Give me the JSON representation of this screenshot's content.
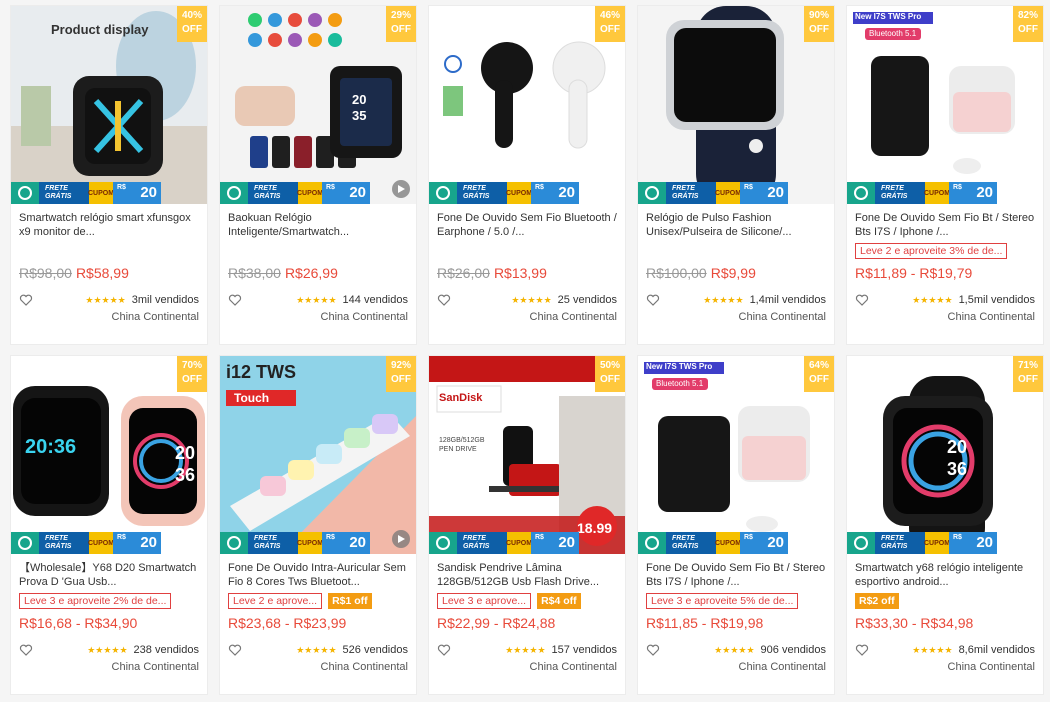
{
  "strip": {
    "frete_line1": "FRETE",
    "frete_line2": "GRÁTIS",
    "cupom": "CUPOM",
    "r_prefix": "R$",
    "r_value": "20"
  },
  "products": [
    {
      "discount": "40%",
      "discount_label": "OFF",
      "image_label": "Product display",
      "title": "Smartwatch relógio smart xfunsgox x9 monitor de...",
      "promo": "",
      "badge": "",
      "price_old": "R$98,00",
      "price": "R$58,99",
      "stars": "★★★★★",
      "sold": "3mil vendidos",
      "location": "China Continental",
      "video": false
    },
    {
      "discount": "29%",
      "discount_label": "OFF",
      "image_label": "",
      "title": "Baokuan Relógio Inteligente/Smartwatch...",
      "promo": "",
      "badge": "",
      "price_old": "R$38,00",
      "price": "R$26,99",
      "stars": "★★★★★",
      "sold": "144 vendidos",
      "location": "China Continental",
      "video": true
    },
    {
      "discount": "46%",
      "discount_label": "OFF",
      "image_label": "",
      "title": "Fone De Ouvido Sem Fio Bluetooth / Earphone / 5.0 /...",
      "promo": "",
      "badge": "",
      "price_old": "R$26,00",
      "price": "R$13,99",
      "stars": "★★★★★",
      "sold": "25 vendidos",
      "location": "China Continental",
      "video": false
    },
    {
      "discount": "90%",
      "discount_label": "OFF",
      "image_label": "",
      "title": "Relógio de Pulso Fashion Unisex/Pulseira de Silicone/...",
      "promo": "",
      "badge": "",
      "price_old": "R$100,00",
      "price": "R$9,99",
      "stars": "★★★★★",
      "sold": "1,4mil vendidos",
      "location": "China Continental",
      "video": false
    },
    {
      "discount": "82%",
      "discount_label": "OFF",
      "image_label": "New I7S TWS Pro",
      "title": "Fone De Ouvido Sem Fio Bt / Stereo Bts I7S / Iphone /...",
      "promo": "Leve 2 e aproveite 3% de de...",
      "badge": "",
      "price_old": "",
      "price": "R$11,89 - R$19,79",
      "stars": "★★★★★",
      "sold": "1,5mil vendidos",
      "location": "China Continental",
      "video": false
    },
    {
      "discount": "70%",
      "discount_label": "OFF",
      "image_label": "",
      "title": "【Wholesale】Y68 D20 Smartwatch Prova D 'Gua Usb...",
      "promo": "Leve 3 e aproveite 2% de de...",
      "badge": "",
      "price_old": "",
      "price": "R$16,68 - R$34,90",
      "stars": "★★★★★",
      "sold": "238 vendidos",
      "location": "China Continental",
      "video": false
    },
    {
      "discount": "92%",
      "discount_label": "OFF",
      "image_label": "i12 TWS",
      "title": "Fone De Ouvido Intra-Auricular Sem Fio 8 Cores Tws Bluetoot...",
      "promo": "Leve 2 e aprove...",
      "badge": "R$1 off",
      "price_old": "",
      "price": "R$23,68 - R$23,99",
      "stars": "★★★★★",
      "sold": "526 vendidos",
      "location": "China Continental",
      "video": true
    },
    {
      "discount": "50%",
      "discount_label": "OFF",
      "image_label": "SanDisk",
      "title": "Sandisk Pendrive Lâmina 128GB/512GB Usb Flash Drive...",
      "promo": "Leve 3 e aprove...",
      "badge": "R$4 off",
      "price_old": "",
      "price": "R$22,99 - R$24,88",
      "stars": "★★★★★",
      "sold": "157 vendidos",
      "location": "China Continental",
      "video": false
    },
    {
      "discount": "64%",
      "discount_label": "OFF",
      "image_label": "New I7S TWS Pro",
      "title": "Fone De Ouvido Sem Fio Bt / Stereo Bts I7S / Iphone /...",
      "promo": "Leve 3 e aproveite 5% de de...",
      "badge": "",
      "price_old": "",
      "price": "R$11,85 - R$19,98",
      "stars": "★★★★★",
      "sold": "906 vendidos",
      "location": "China Continental",
      "video": false
    },
    {
      "discount": "71%",
      "discount_label": "OFF",
      "image_label": "",
      "title": "Smartwatch y68 relógio inteligente esportivo android...",
      "promo": "",
      "badge": "R$2 off",
      "price_old": "",
      "price": "R$33,30 - R$34,98",
      "stars": "★★★★★",
      "sold": "8,6mil vendidos",
      "location": "China Continental",
      "video": false
    }
  ],
  "image_texts": {
    "watch1_face": "X",
    "watch2_time1": "20",
    "watch2_time2": "35",
    "watch6_time1": "20:36",
    "watch6_time2": "20",
    "watch6_time3": "36",
    "watch10_time1": "20",
    "watch10_time2": "36",
    "tws_touch": "Touch",
    "bt_label": "Bluetooth 5.1",
    "pendrive_caption": "128GB/512GB PEN DRIVE",
    "pendrive_price": "18.99"
  },
  "colors": {
    "discount_bg": "#ffc83d",
    "price": "#e84a3a",
    "promo_border": "#e04040",
    "badge_bg": "#f39c12",
    "star": "#f5b400"
  }
}
